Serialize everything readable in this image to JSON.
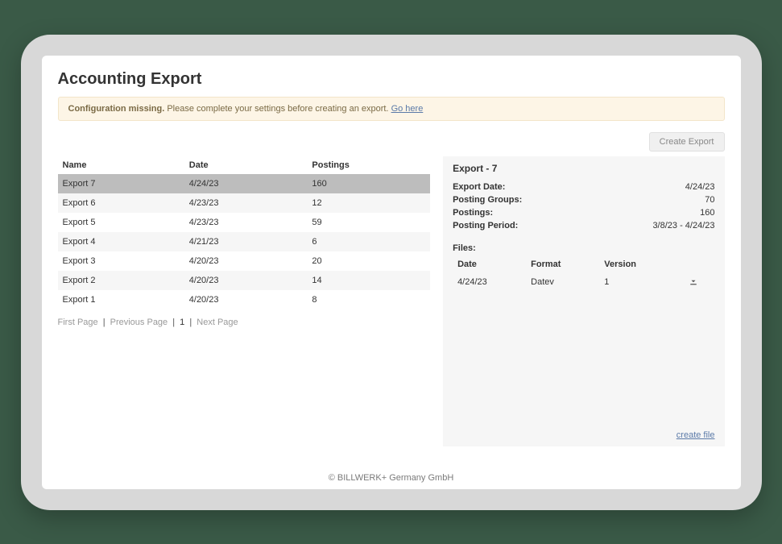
{
  "page": {
    "title": "Accounting Export"
  },
  "alert": {
    "strong": "Configuration missing.",
    "text": " Please complete your settings before creating an export. ",
    "link": "Go here"
  },
  "toolbar": {
    "create_export": "Create Export"
  },
  "exports": {
    "headers": {
      "name": "Name",
      "date": "Date",
      "postings": "Postings"
    },
    "rows": [
      {
        "name": "Export 7",
        "date": "4/24/23",
        "postings": "160",
        "selected": true
      },
      {
        "name": "Export 6",
        "date": "4/23/23",
        "postings": "12"
      },
      {
        "name": "Export 5",
        "date": "4/23/23",
        "postings": "59"
      },
      {
        "name": "Export 4",
        "date": "4/21/23",
        "postings": "6"
      },
      {
        "name": "Export 3",
        "date": "4/20/23",
        "postings": "20"
      },
      {
        "name": "Export 2",
        "date": "4/20/23",
        "postings": "14"
      },
      {
        "name": "Export 1",
        "date": "4/20/23",
        "postings": "8"
      }
    ]
  },
  "pagination": {
    "first": "First Page",
    "previous": "Previous Page",
    "current": "1",
    "next": "Next Page"
  },
  "detail": {
    "title": "Export - 7",
    "rows": [
      {
        "k": "Export Date:",
        "v": "4/24/23"
      },
      {
        "k": "Posting Groups:",
        "v": "70"
      },
      {
        "k": "Postings:",
        "v": "160"
      },
      {
        "k": "Posting Period:",
        "v": "3/8/23 - 4/24/23"
      }
    ],
    "files_title": "Files:",
    "files_headers": {
      "date": "Date",
      "format": "Format",
      "version": "Version"
    },
    "files": [
      {
        "date": "4/24/23",
        "format": "Datev",
        "version": "1"
      }
    ],
    "create_file": "create file"
  },
  "footer": {
    "text": "© BILLWERK+ Germany GmbH"
  }
}
